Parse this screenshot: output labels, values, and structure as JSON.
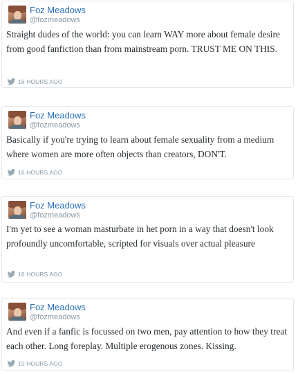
{
  "tweets": [
    {
      "author_name": "Foz Meadows",
      "author_handle": "@fozmeadows",
      "text": "Straight dudes of the world: you can learn WAY more about female desire from good fanfiction than from mainstream porn. TRUST ME ON THIS.",
      "timestamp": "16 HOURS AGO"
    },
    {
      "author_name": "Foz Meadows",
      "author_handle": "@fozmeadows",
      "text": "Basically if you're trying to learn about female sexuality from a medium where women are more often objects than creators, DON'T.",
      "timestamp": "16 HOURS AGO"
    },
    {
      "author_name": "Foz Meadows",
      "author_handle": "@fozmeadows",
      "text": "I'm yet to see a woman masturbate in het porn in a way that doesn't look profoundly uncomfortable, scripted for visuals over actual pleasure",
      "timestamp": "16 HOURS AGO"
    },
    {
      "author_name": "Foz Meadows",
      "author_handle": "@fozmeadows",
      "text": "And even if a fanfic is focussed on two men, pay attention to how they treat each other. Long foreplay. Multiple erogenous zones. Kissing.",
      "timestamp": "15 HOURS AGO"
    }
  ],
  "icons": {
    "avatar": "profile-photo",
    "timestamp_icon": "twitter-bird-icon"
  },
  "colors": {
    "name": "#2a6fb5",
    "handle": "#8899a6",
    "text": "#292f33",
    "border": "#e1e8ed"
  }
}
